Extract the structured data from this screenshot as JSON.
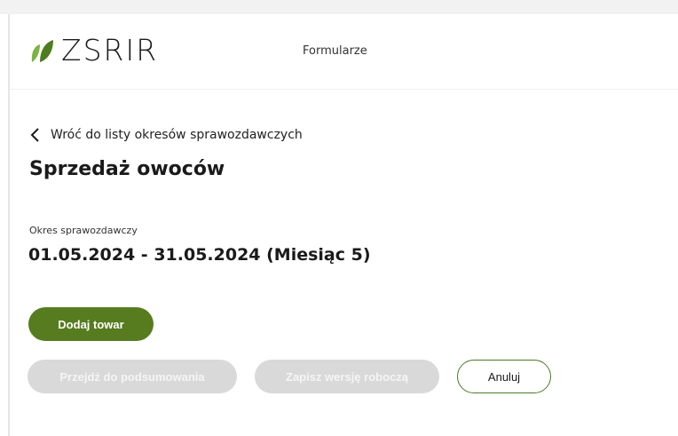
{
  "header": {
    "logo_text": "ZSRIR",
    "nav_item": "Formularze"
  },
  "back": {
    "label": "Wróć do listy okresów sprawozdawczych"
  },
  "page": {
    "title": "Sprzedaż owoców"
  },
  "period": {
    "label": "Okres sprawozdawczy",
    "value": "01.05.2024 - 31.05.2024 (Miesiąc 5)"
  },
  "actions": {
    "add_label": "Dodaj towar",
    "summary_label": "Przejdź do podsumowania",
    "draft_label": "Zapisz wersję roboczą",
    "cancel_label": "Anuluj"
  },
  "colors": {
    "brand_green": "#577c1f",
    "logo_green": "#7cb342",
    "disabled_gray": "#d9d9d9"
  },
  "icons": {
    "logo": "leaf-logo-icon",
    "back": "chevron-left-icon"
  }
}
